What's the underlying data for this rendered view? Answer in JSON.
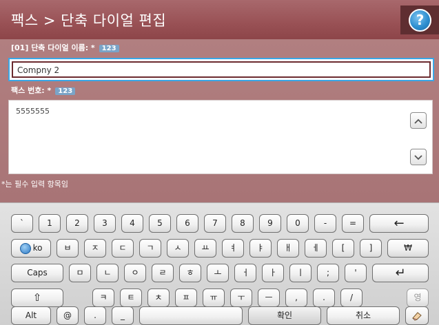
{
  "header": {
    "title": "팩스 > 단축 다이얼 편집",
    "help_label": "?"
  },
  "form": {
    "name_label": "[01] 단축 다이얼 이름: *",
    "name_badge": "123",
    "name_value": "Compny 2",
    "number_label": "팩스 번호: *",
    "number_badge": "123",
    "number_value": "5555555",
    "required_note": "*는 필수 입력 항목임"
  },
  "keyboard": {
    "row1": [
      "`",
      "1",
      "2",
      "3",
      "4",
      "5",
      "6",
      "7",
      "8",
      "9",
      "0",
      "-",
      "="
    ],
    "backspace": "←",
    "lang_label": "ko",
    "row2": [
      "ㅂ",
      "ㅈ",
      "ㄷ",
      "ㄱ",
      "ㅅ",
      "ㅛ",
      "ㅕ",
      "ㅑ",
      "ㅐ",
      "ㅔ",
      "[",
      "]",
      "₩"
    ],
    "caps_label": "Caps",
    "row3": [
      "ㅁ",
      "ㄴ",
      "ㅇ",
      "ㄹ",
      "ㅎ",
      "ㅗ",
      "ㅓ",
      "ㅏ",
      "ㅣ",
      ";",
      "'"
    ],
    "enter": "↵",
    "shift": "⇧",
    "row4": [
      "ㅋ",
      "ㅌ",
      "ㅊ",
      "ㅍ",
      "ㅠ",
      "ㅜ",
      "ㅡ",
      ",",
      ".",
      "/"
    ],
    "mode_key": "영",
    "alt_label": "Alt",
    "at_label": "@",
    "dot_label": ".",
    "underscore_label": "_",
    "confirm_label": "확인",
    "cancel_label": "취소"
  },
  "colors": {
    "header": "#995155",
    "form_bg": "#ab7779",
    "focus_outline": "#3aa7e6",
    "keyboard_bg": "#d8d8d8"
  }
}
